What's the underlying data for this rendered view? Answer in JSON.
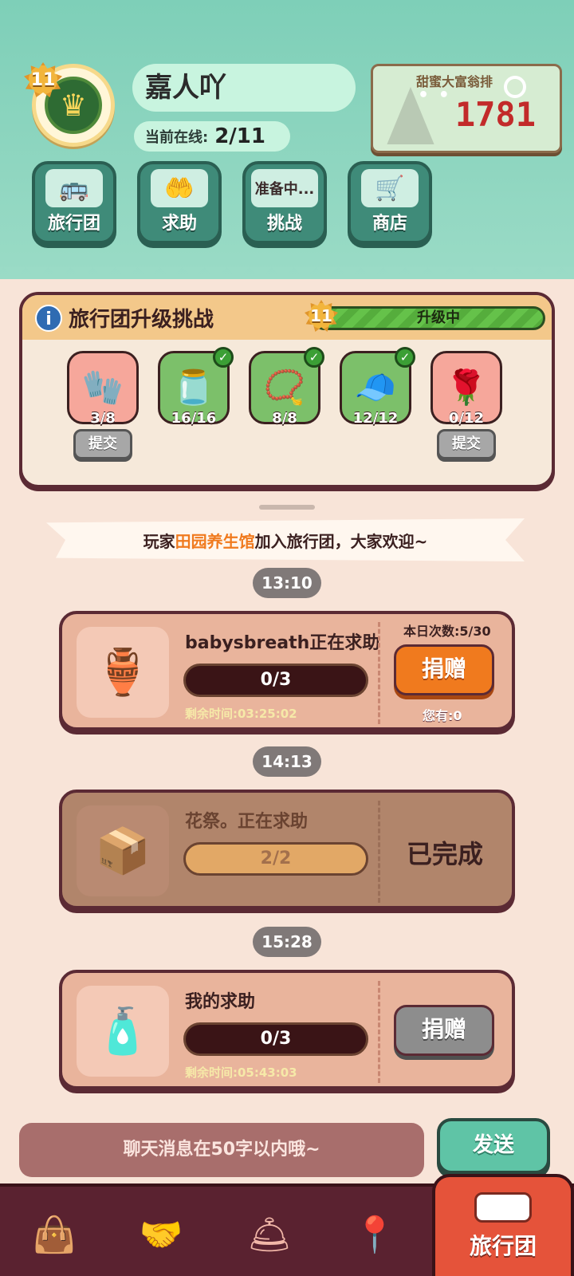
{
  "player": {
    "level": "11",
    "name": "嘉人吖",
    "online_label": "当前在线:",
    "online_value": "2/11"
  },
  "rank_card": {
    "title": "甜蜜大富翁排",
    "value": "1781",
    "dots": "• •"
  },
  "top_buttons": [
    {
      "label": "旅行团",
      "icon": "bus-icon"
    },
    {
      "label": "求助",
      "icon": "hands-icon"
    },
    {
      "label": "挑战",
      "status": "准备中..."
    },
    {
      "label": "商店",
      "icon": "cart-icon"
    }
  ],
  "upgrade": {
    "info_icon": "i",
    "title": "旅行团升级挑战",
    "level": "11",
    "status": "升级中",
    "items": [
      {
        "name": "gloves",
        "count": "3/8",
        "done": false
      },
      {
        "name": "caviar",
        "count": "16/16",
        "done": true
      },
      {
        "name": "bracelet",
        "count": "8/8",
        "done": true
      },
      {
        "name": "cap",
        "count": "12/12",
        "done": true
      },
      {
        "name": "necklace",
        "count": "0/12",
        "done": false
      }
    ],
    "submit_label_1": "提交",
    "submit_label_2": "提交",
    "check": "✓"
  },
  "welcome": {
    "prefix": "玩家",
    "name": "田园养生馆",
    "suffix": "加入旅行团，大家欢迎~"
  },
  "feed": {
    "time_1": "13:10",
    "time_2": "14:13",
    "time_3": "15:28",
    "card_1": {
      "title": "babysbreath正在求助",
      "progress": "0/3",
      "remaining": "剩余时间:03:25:02",
      "daily_count": "本日次数:5/30",
      "donate_label": "捐赠",
      "you_have": "您有:0"
    },
    "card_2": {
      "title": "花祭。正在求助",
      "progress": "2/2",
      "completed": "已完成"
    },
    "card_3": {
      "title": "我的求助",
      "progress": "0/3",
      "remaining": "剩余时间:05:43:03",
      "donate_label": "捐赠"
    }
  },
  "chat": {
    "placeholder": "聊天消息在50字以内哦~",
    "send_label": "发送"
  },
  "bottom_nav": {
    "active_label": "旅行团"
  }
}
